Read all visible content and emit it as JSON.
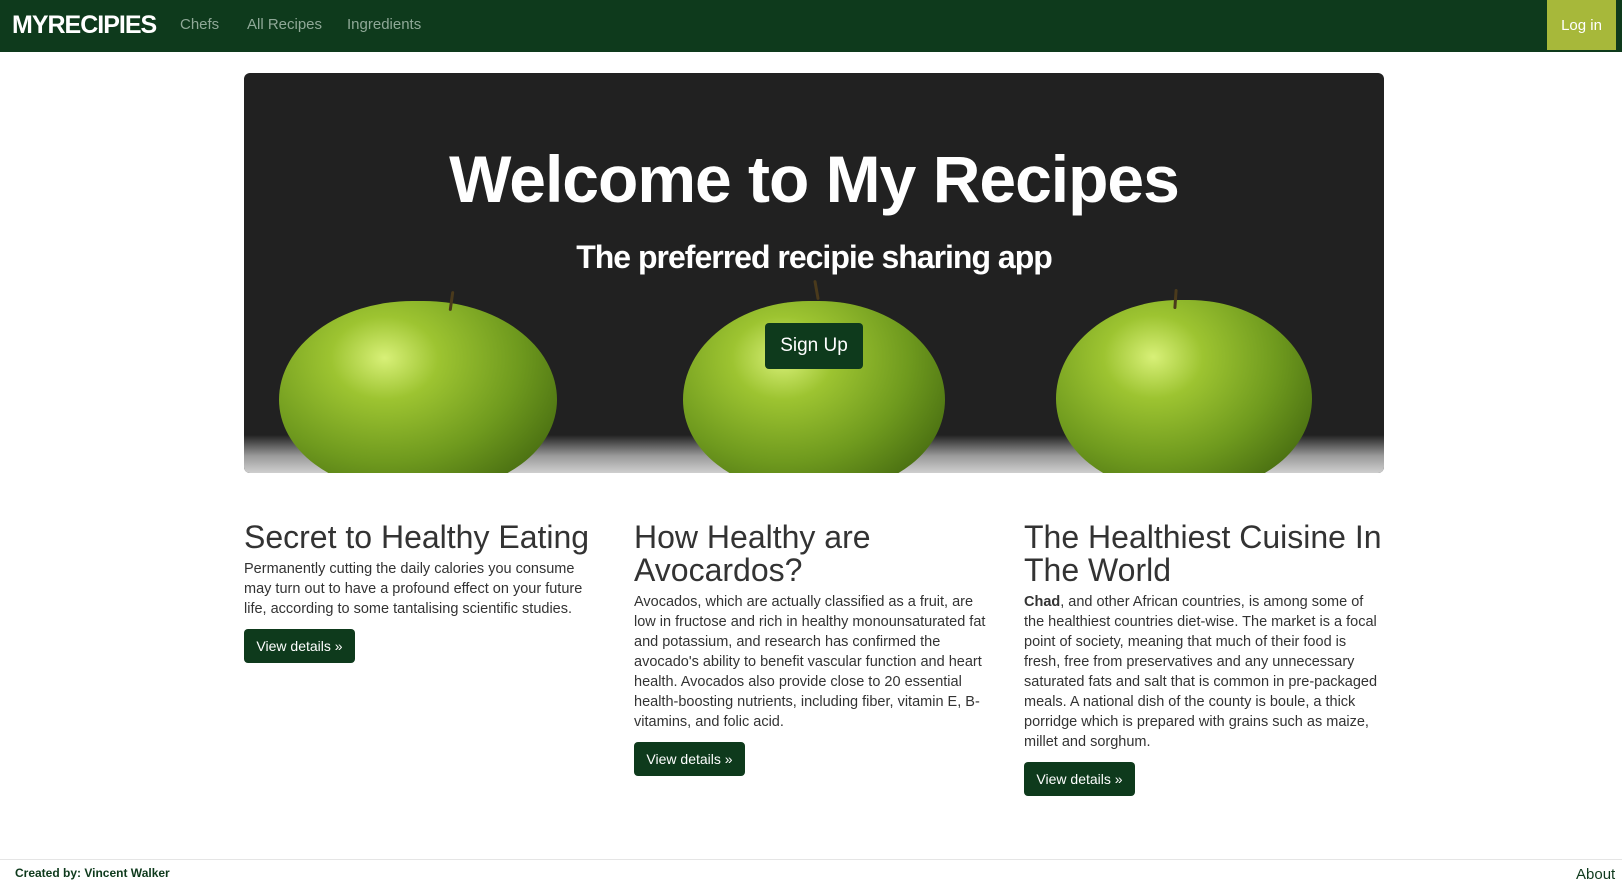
{
  "navbar": {
    "brand": "MYRECIPIES",
    "links": [
      "Chefs",
      "All Recipes",
      "Ingredients"
    ],
    "login_label": "Log in"
  },
  "hero": {
    "title": "Welcome to My Recipes",
    "subtitle": "The preferred recipie sharing app",
    "signup_label": "Sign Up"
  },
  "columns": [
    {
      "title": "Secret to Healthy Eating",
      "text": "Permanently cutting the daily calories you consume may turn out to have a profound effect on your future life, according to some tantalising scientific studies.",
      "button": "View details »"
    },
    {
      "title": "How Healthy are Avocardos?",
      "text": "Avocados, which are actually classified as a fruit, are low in fructose and rich in healthy monounsaturated fat and potassium, and research has confirmed the avocado's ability to benefit vascular function and heart health. Avocados also provide close to 20 essential health-boosting nutrients, including fiber, vitamin E, B-vitamins, and folic acid.",
      "button": "View details »"
    },
    {
      "title": "The Healthiest Cuisine In The World",
      "text_bold": "Chad",
      "text": ", and other African countries, is among some of the healthiest countries diet-wise. The market is a focal point of society, meaning that much of their food is fresh, free from preservatives and any unnecessary saturated fats and salt that is common in pre-packaged meals. A national dish of the county is boule, a thick porridge which is prepared with grains such as maize, millet and sorghum.",
      "button": "View details »"
    }
  ],
  "footer": {
    "credit": "Created by: Vincent Walker",
    "about": "About"
  },
  "colors": {
    "primary": "#0e3a1c",
    "accent": "#a7b83a",
    "hero_bg": "#212121"
  }
}
